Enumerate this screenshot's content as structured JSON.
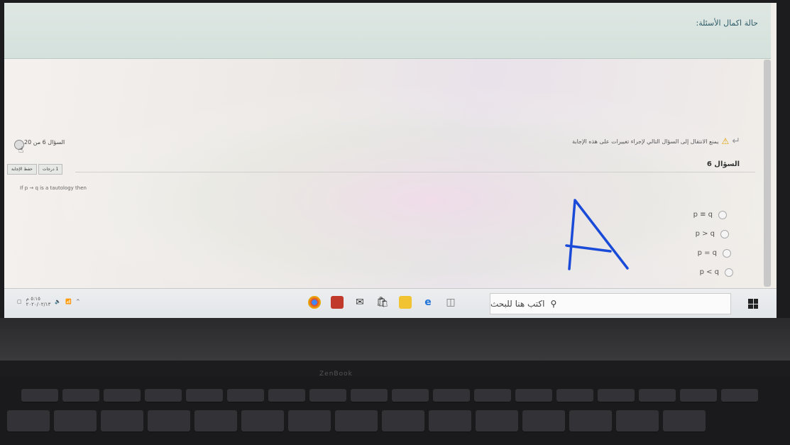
{
  "banner": {
    "text": "حالة اكمال الأسئلة:"
  },
  "question": {
    "warning": "يمنع الانتقال إلى السؤال التالي لإجراء تغييرات على هذه الإجابة",
    "title": "السؤال 6",
    "counter": "السؤال 6 من 20",
    "points": "1 درجات",
    "save_label": "حفظ الإجابة",
    "text": "If p → q is a tautology then",
    "options": [
      {
        "label": "p ≡ q"
      },
      {
        "label": "p > q"
      },
      {
        "label": "p = q"
      },
      {
        "label": "p < q"
      }
    ]
  },
  "handwriting": {
    "text": "A",
    "color": "#1a4ad8"
  },
  "taskbar": {
    "search_placeholder": "اكتب هنا للبحث",
    "clock_time": "٥:١٥ م",
    "clock_date": "٢٠٢٠/٠٢/١٣"
  },
  "laptop": {
    "brand": "ZenBook"
  }
}
